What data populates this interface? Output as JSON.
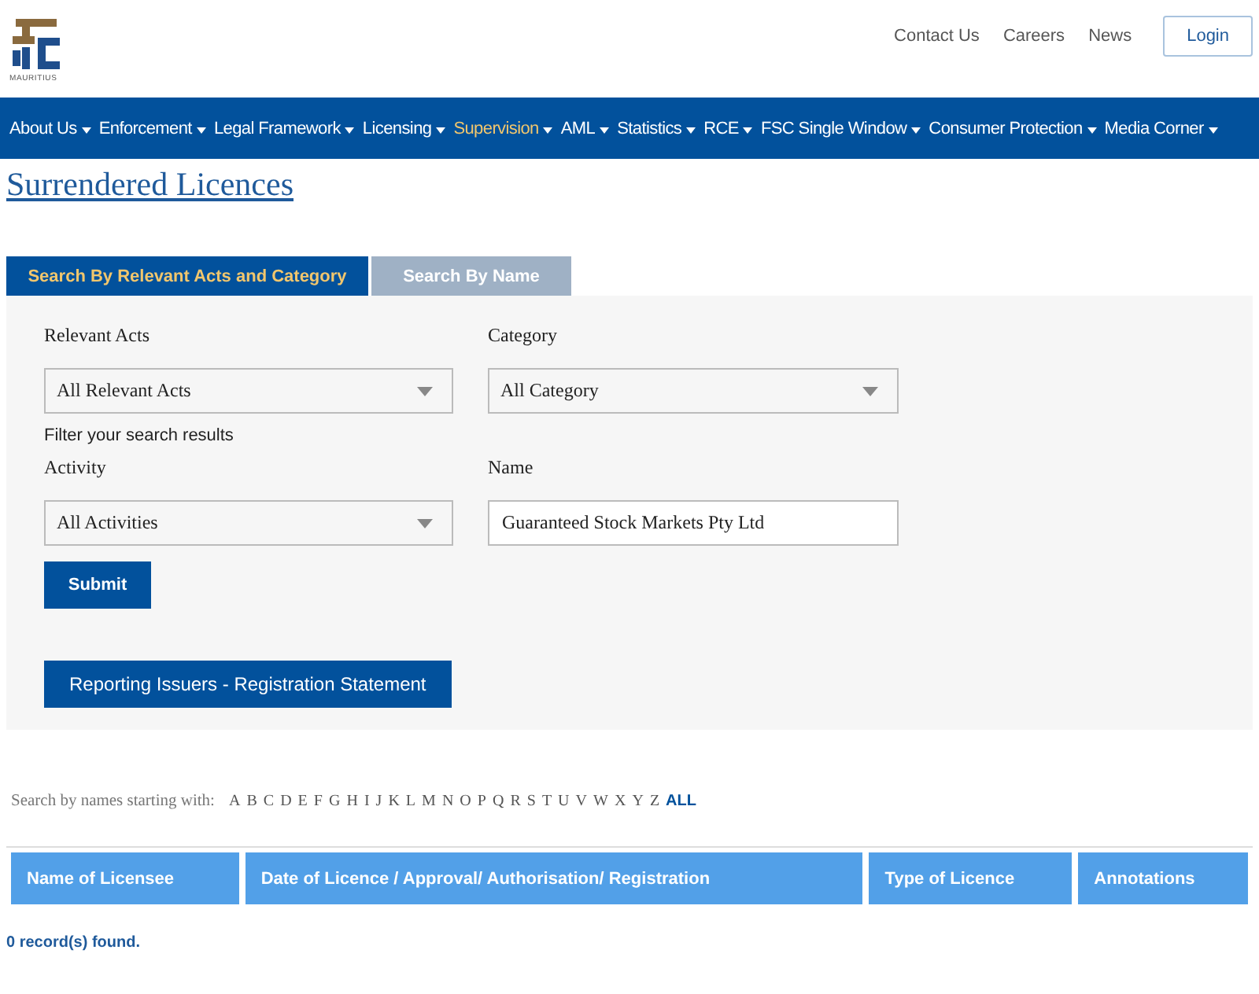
{
  "logo": {
    "caption": "MAURITIUS"
  },
  "top_links": [
    "Contact Us",
    "Careers",
    "News"
  ],
  "login_button": "Login",
  "nav": [
    {
      "label": "About Us",
      "selected": false
    },
    {
      "label": "Enforcement",
      "selected": false
    },
    {
      "label": "Legal Framework",
      "selected": false
    },
    {
      "label": "Licensing",
      "selected": false
    },
    {
      "label": "Supervision",
      "selected": true
    },
    {
      "label": "AML",
      "selected": false
    },
    {
      "label": "Statistics",
      "selected": false
    },
    {
      "label": "RCE",
      "selected": false
    },
    {
      "label": "FSC Single Window",
      "selected": false
    },
    {
      "label": "Consumer Protection",
      "selected": false
    },
    {
      "label": "Media Corner",
      "selected": false
    }
  ],
  "page_title": "Surrendered Licences",
  "tabs": [
    {
      "label": "Search By Relevant Acts and Category",
      "selected": true
    },
    {
      "label": "Search By Name",
      "selected": false
    }
  ],
  "form": {
    "relevant_acts": {
      "label": "Relevant Acts",
      "value": "All Relevant Acts"
    },
    "category": {
      "label": "Category",
      "value": "All Category"
    },
    "filter_heading": "Filter your search results",
    "activity": {
      "label": "Activity",
      "value": "All Activities"
    },
    "name": {
      "label": "Name",
      "value": "Guaranteed Stock Markets Pty Ltd"
    },
    "submit": "Submit",
    "reporting_button": "Reporting Issuers - Registration Statement"
  },
  "alphabet": {
    "label": "Search by names starting with:",
    "letters": [
      {
        "label": "A",
        "selected": false
      },
      {
        "label": "B",
        "selected": false
      },
      {
        "label": "C",
        "selected": false
      },
      {
        "label": "D",
        "selected": false
      },
      {
        "label": "E",
        "selected": false
      },
      {
        "label": "F",
        "selected": false
      },
      {
        "label": "G",
        "selected": false
      },
      {
        "label": "H",
        "selected": false
      },
      {
        "label": "I",
        "selected": false
      },
      {
        "label": "J",
        "selected": false
      },
      {
        "label": "K",
        "selected": false
      },
      {
        "label": "L",
        "selected": false
      },
      {
        "label": "M",
        "selected": false
      },
      {
        "label": "N",
        "selected": false
      },
      {
        "label": "O",
        "selected": false
      },
      {
        "label": "P",
        "selected": false
      },
      {
        "label": "Q",
        "selected": false
      },
      {
        "label": "R",
        "selected": false
      },
      {
        "label": "S",
        "selected": false
      },
      {
        "label": "T",
        "selected": false
      },
      {
        "label": "U",
        "selected": false
      },
      {
        "label": "V",
        "selected": false
      },
      {
        "label": "W",
        "selected": false
      },
      {
        "label": "X",
        "selected": false
      },
      {
        "label": "Y",
        "selected": false
      },
      {
        "label": "Z",
        "selected": false
      },
      {
        "label": "ALL",
        "selected": true
      }
    ]
  },
  "table": {
    "columns": [
      "Name of Licensee",
      "Date of Licence / Approval/ Authorisation/ Registration",
      "Type of Licence",
      "Annotations"
    ]
  },
  "result_count": "0 record(s) found."
}
